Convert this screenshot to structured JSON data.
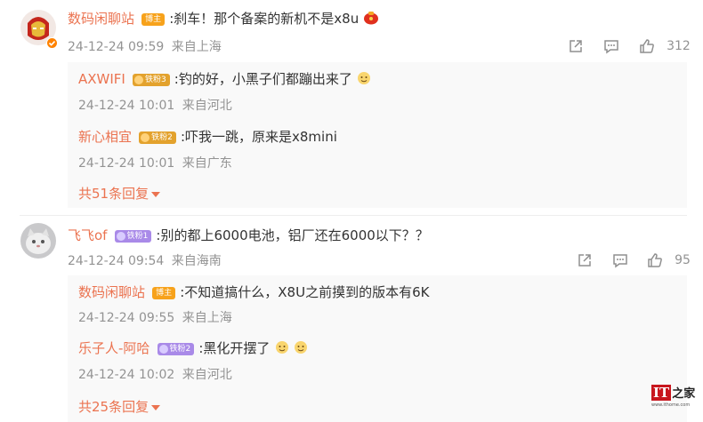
{
  "comments": [
    {
      "author": "数码闲聊站",
      "badge": "博主",
      "text": ":刹车！那个备案的新机不是x8u",
      "time": "24-12-24 09:59",
      "location": "来自上海",
      "likes": "312",
      "replies": [
        {
          "author": "AXWIFI",
          "badge": "铁粉3",
          "text": ":钓的好，小黑子们都蹦出来了",
          "time": "24-12-24 10:01",
          "location": "来自河北"
        },
        {
          "author": "新心相宜",
          "badge": "铁粉2",
          "text": ":吓我一跳，原来是x8mini",
          "time": "24-12-24 10:01",
          "location": "来自广东"
        }
      ],
      "more_replies": "共51条回复"
    },
    {
      "author": "飞飞of",
      "badge": "铁粉1",
      "text": ":别的都上6000电池，铝厂还在6000以下？？",
      "time": "24-12-24 09:54",
      "location": "来自海南",
      "likes": "95",
      "replies": [
        {
          "author": "数码闲聊站",
          "badge": "博主",
          "text": ":不知道搞什么，X8U之前摸到的版本有6K",
          "time": "24-12-24 09:55",
          "location": "来自上海"
        },
        {
          "author": "乐子人-阿哈",
          "badge": "铁粉2",
          "text": ":黑化开摆了",
          "time": "24-12-24 10:02",
          "location": "来自河北"
        }
      ],
      "more_replies": "共25条回复"
    }
  ],
  "watermark": {
    "logo": "IT",
    "suffix": "之家",
    "url": "www.ithome.com"
  },
  "colors": {
    "name": "#eb7350",
    "meta": "#939393",
    "text": "#333333",
    "blogger_badge": "#f7a21b",
    "fan_badge": "#e3a22d",
    "ironfan_badge": "#a98ae8"
  },
  "icons": [
    "share-icon",
    "comment-icon",
    "like-icon",
    "emoji-icon",
    "red-envelope-icon",
    "verified-icon",
    "caret-down-icon"
  ]
}
